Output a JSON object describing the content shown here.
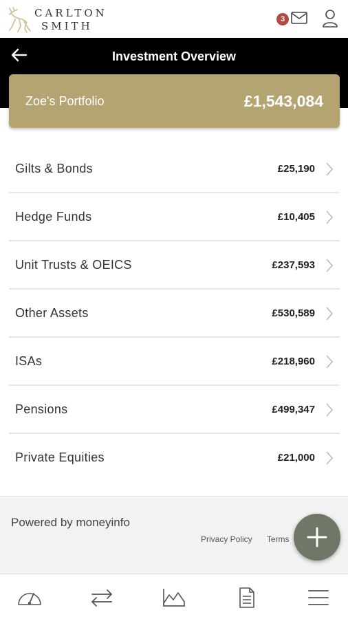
{
  "brand": {
    "line1": "CARLTON",
    "line2": "SMITH"
  },
  "header": {
    "unread_count": "3"
  },
  "page": {
    "title": "Investment Overview"
  },
  "portfolio": {
    "name": "Zoe's Portfolio",
    "total": "£1,543,084"
  },
  "investments": [
    {
      "label": "Gilts & Bonds",
      "value": "£25,190"
    },
    {
      "label": "Hedge Funds",
      "value": "£10,405"
    },
    {
      "label": "Unit Trusts & OEICS",
      "value": "£237,593"
    },
    {
      "label": "Other Assets",
      "value": "£530,589"
    },
    {
      "label": "ISAs",
      "value": "£218,960"
    },
    {
      "label": "Pensions",
      "value": "£499,347"
    },
    {
      "label": "Private Equities",
      "value": "£21,000"
    }
  ],
  "footer": {
    "powered_by": "Powered by moneyinfo",
    "privacy": "Privacy Policy",
    "terms": "Terms"
  },
  "colors": {
    "gold": "#b4a471",
    "badge": "#b04a44",
    "fab": "#6f7866",
    "band": "#000000"
  },
  "icons": {
    "logo": "deer-logo-icon",
    "mail": "mail-icon",
    "user": "user-icon",
    "back": "back-arrow-icon",
    "chevron": "chevron-right-icon",
    "fab": "plus-icon",
    "nav": [
      "dashboard-gauge-icon",
      "transfer-arrows-icon",
      "area-chart-icon",
      "document-icon",
      "menu-icon"
    ]
  }
}
